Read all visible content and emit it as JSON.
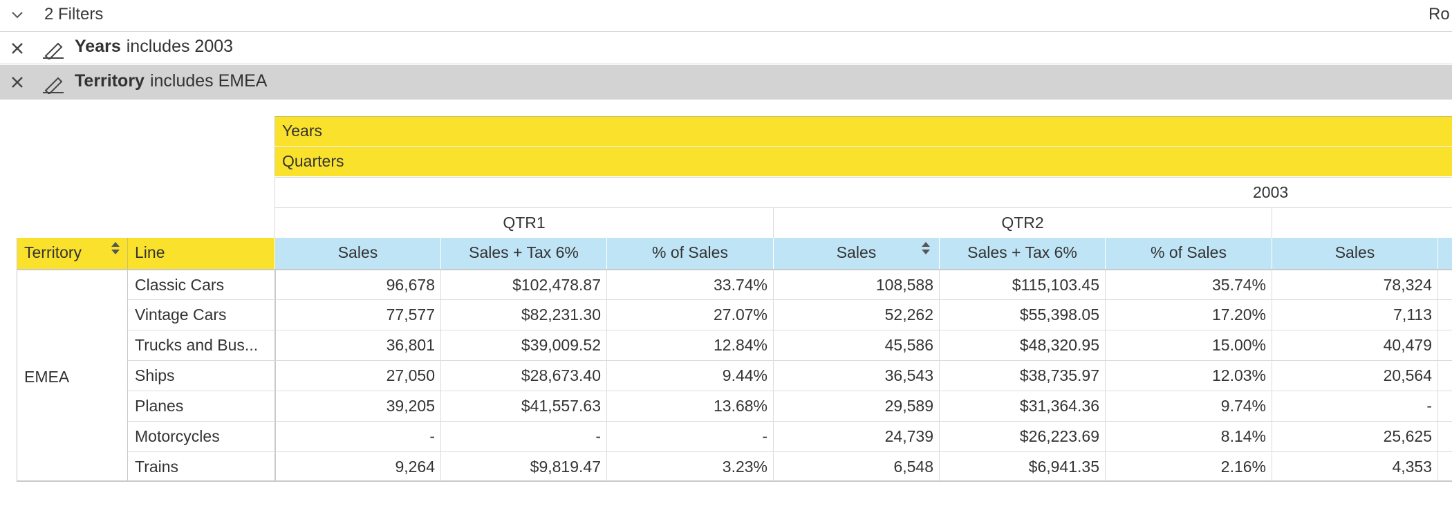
{
  "filters": {
    "toggle_icon": "chevron-down-icon",
    "count_label": "2 Filters",
    "right_label": "Ro",
    "items": [
      {
        "field": "Years",
        "condition": "includes 2003"
      },
      {
        "field": "Territory",
        "condition": "includes EMEA"
      }
    ]
  },
  "pivot": {
    "col_dims": [
      "Years",
      "Quarters"
    ],
    "year": "2003",
    "quarters": [
      "QTR1",
      "QTR2"
    ],
    "row_headers": {
      "territory": "Territory",
      "line": "Line"
    },
    "measures": [
      "Sales",
      "Sales + Tax 6%",
      "% of Sales",
      "Sales",
      "Sales + Tax 6%",
      "% of Sales",
      "Sales"
    ],
    "territory_value": "EMEA",
    "rows": [
      {
        "line": "Classic Cars",
        "values": [
          "96,678",
          "$102,478.87",
          "33.74%",
          "108,588",
          "$115,103.45",
          "35.74%",
          "78,324"
        ]
      },
      {
        "line": "Vintage Cars",
        "values": [
          "77,577",
          "$82,231.30",
          "27.07%",
          "52,262",
          "$55,398.05",
          "17.20%",
          "7,113"
        ]
      },
      {
        "line": "Trucks and Bus...",
        "values": [
          "36,801",
          "$39,009.52",
          "12.84%",
          "45,586",
          "$48,320.95",
          "15.00%",
          "40,479"
        ]
      },
      {
        "line": "Ships",
        "values": [
          "27,050",
          "$28,673.40",
          "9.44%",
          "36,543",
          "$38,735.97",
          "12.03%",
          "20,564"
        ]
      },
      {
        "line": "Planes",
        "values": [
          "39,205",
          "$41,557.63",
          "13.68%",
          "29,589",
          "$31,364.36",
          "9.74%",
          "-"
        ]
      },
      {
        "line": "Motorcycles",
        "values": [
          "-",
          "-",
          "-",
          "24,739",
          "$26,223.69",
          "8.14%",
          "25,625"
        ]
      },
      {
        "line": "Trains",
        "values": [
          "9,264",
          "$9,819.47",
          "3.23%",
          "6,548",
          "$6,941.35",
          "2.16%",
          "4,353"
        ]
      }
    ]
  },
  "colors": {
    "dimension_header": "#fae22c",
    "measure_header": "#bfe4f5",
    "active_filter_row": "#d3d3d3"
  }
}
